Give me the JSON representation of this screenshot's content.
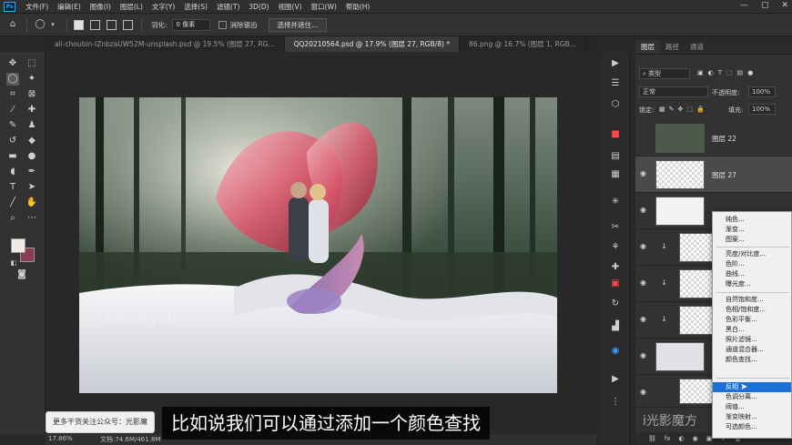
{
  "menubar": {
    "items": [
      "文件(F)",
      "编辑(E)",
      "图像(I)",
      "图层(L)",
      "文字(Y)",
      "选择(S)",
      "滤镜(T)",
      "3D(D)",
      "视图(V)",
      "窗口(W)",
      "帮助(H)"
    ],
    "logo": "Ps",
    "window_controls": [
      "—",
      "▢",
      "✕"
    ]
  },
  "options_bar": {
    "feather_label": "羽化:",
    "feather_value": "0 像素",
    "antialias_label": "消除锯齿",
    "select_mask_button": "选择并遮住..."
  },
  "tabs": [
    {
      "label": "ali-choubin-IZnbzaUW52M-unsplash.psd @ 19.5% (图层 27, RG...",
      "active": false
    },
    {
      "label": "QQ20210564.psd @ 17.9% (图层 27, RGB/8) *",
      "active": true
    },
    {
      "label": "86.png @ 16.7% (图层 1, RGB...",
      "active": false
    }
  ],
  "status": {
    "zoom": "17.86%",
    "doc_size": "文档:74.6M/461.8M"
  },
  "overlays": {
    "promo_text": "更多干货关注公众号：光影魔",
    "subtitle": "比如说我们可以通过添加一个颜色查找",
    "brand": "i光影魔方",
    "photo_caption": "I love you"
  },
  "layers_panel": {
    "tabs": [
      "图层",
      "路径",
      "通道"
    ],
    "filter_kind": "类型",
    "blend_mode": "正常",
    "opacity_label": "不透明度:",
    "opacity_value": "100%",
    "lock_label": "锁定:",
    "fill_label": "填充:",
    "fill_value": "100%",
    "layers": [
      {
        "name": "图层 22",
        "visible": false,
        "selected": false
      },
      {
        "name": "图层 27",
        "visible": true,
        "selected": true
      },
      {
        "name": "",
        "visible": true,
        "selected": false
      },
      {
        "name": "",
        "visible": true,
        "selected": false
      },
      {
        "name": "",
        "visible": true,
        "selected": false
      },
      {
        "name": "",
        "visible": true,
        "selected": false
      },
      {
        "name": "",
        "visible": true,
        "selected": false
      },
      {
        "name": "",
        "visible": true,
        "selected": false
      }
    ],
    "bottom_icons": [
      "⛓",
      "fx",
      "◐",
      "◉",
      "▣",
      "+",
      "🗑"
    ]
  },
  "adjustment_menu": {
    "groups": [
      [
        "纯色...",
        "渐变...",
        "图案..."
      ],
      [
        "亮度/对比度...",
        "色阶...",
        "曲线...",
        "曝光度..."
      ],
      [
        "自然饱和度...",
        "色相/饱和度...",
        "色彩平衡...",
        "黑白...",
        "照片滤镜...",
        "通道混合器...",
        "颜色查找..."
      ],
      [
        "反相",
        "色调分离...",
        "阈值...",
        "渐变映射...",
        "可选颜色..."
      ]
    ],
    "highlighted": "反相"
  },
  "colors": {
    "foreground": "#f3e9e4",
    "background": "#8a3b55",
    "highlight": "#1c6fd6"
  }
}
